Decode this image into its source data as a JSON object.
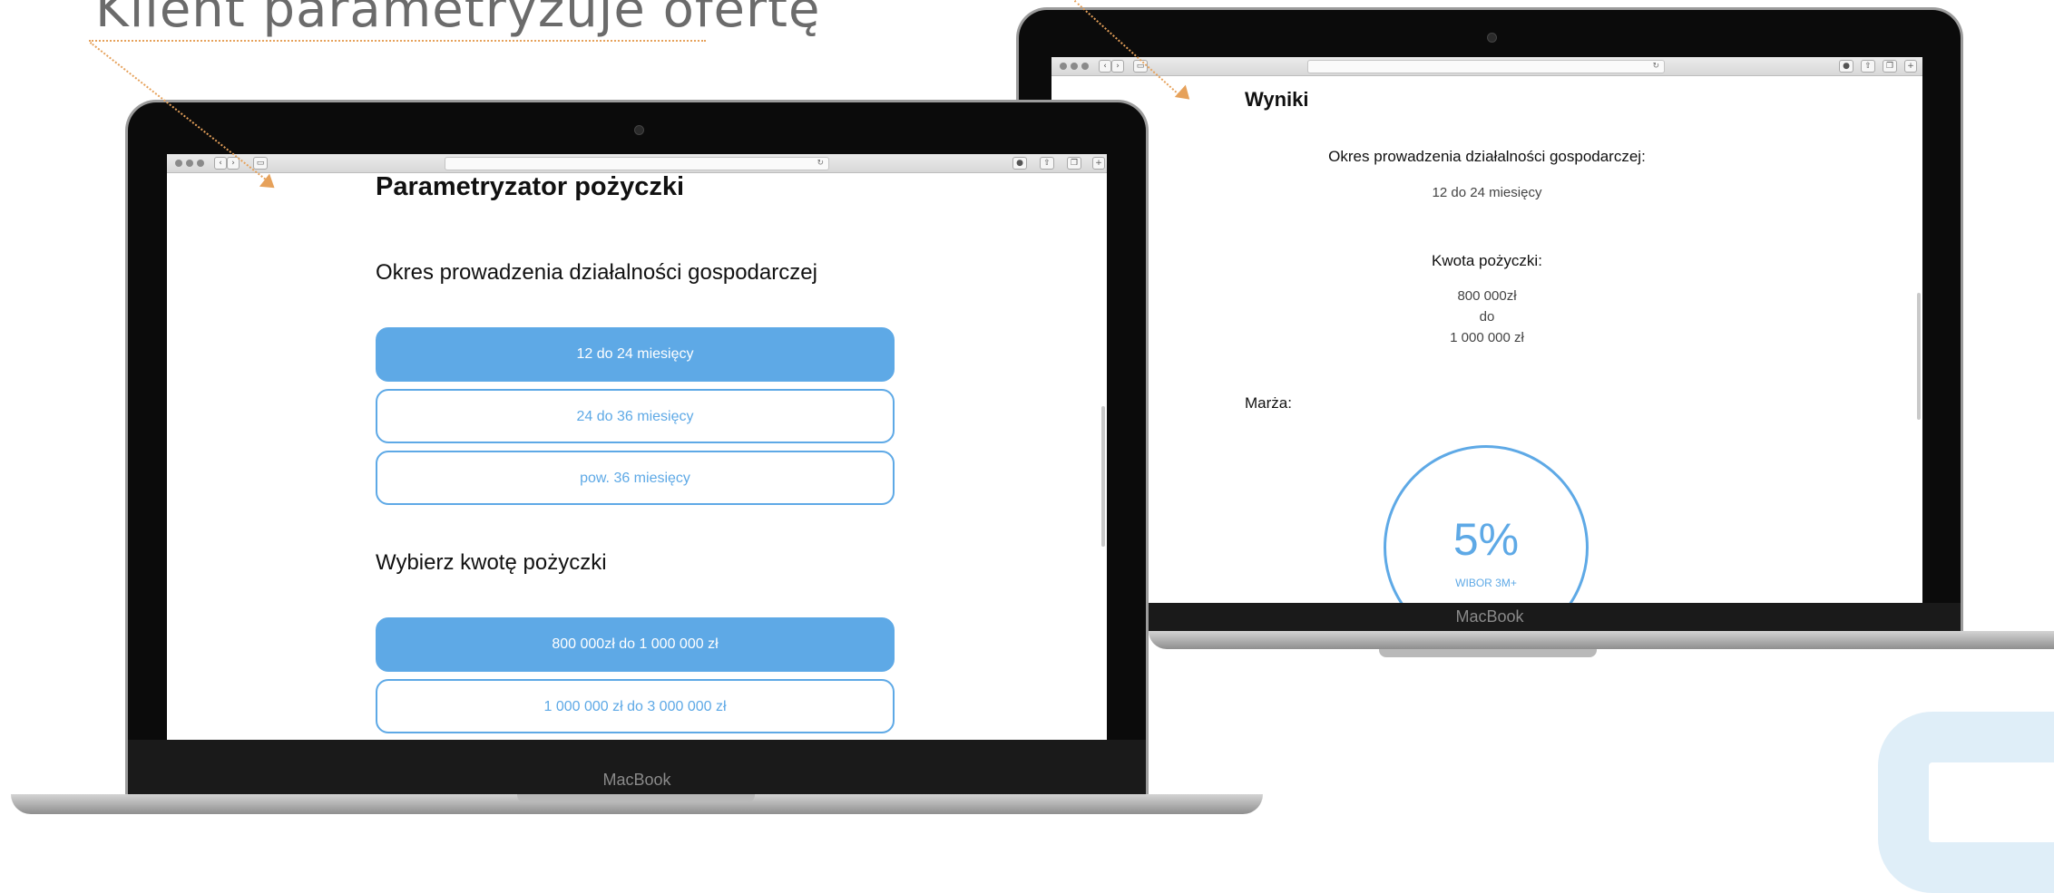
{
  "slide": {
    "title": "Klient parametryzuje ofertę",
    "accent_color": "#e6a15a",
    "brand_color": "#5ea9e6"
  },
  "left_laptop": {
    "brand": "MacBook",
    "page": {
      "title": "Parametryzator pożyczki",
      "period_heading": "Okres prowadzenia działalności gospodarczej",
      "period_options": [
        {
          "label": "12 do 24 miesięcy",
          "selected": true
        },
        {
          "label": "24 do 36 miesięcy",
          "selected": false
        },
        {
          "label": "pow. 36 miesięcy",
          "selected": false
        }
      ],
      "amount_heading": "Wybierz kwotę pożyczki",
      "amount_options": [
        {
          "label": "800 000zł do 1 000 000 zł",
          "selected": true
        },
        {
          "label": "1 000 000 zł do 3 000 000 zł",
          "selected": false
        }
      ]
    }
  },
  "right_laptop": {
    "brand": "MacBook",
    "page": {
      "title": "Wyniki",
      "period_label": "Okres prowadzenia działalności gospodarczej:",
      "period_value": "12 do 24 miesięcy",
      "amount_label": "Kwota pożyczki:",
      "amount_lines": [
        "800 000zł",
        "do",
        "1 000 000 zł"
      ],
      "margin_label": "Marża:",
      "margin_value": "5%",
      "margin_base": "WIBOR 3M+"
    }
  }
}
